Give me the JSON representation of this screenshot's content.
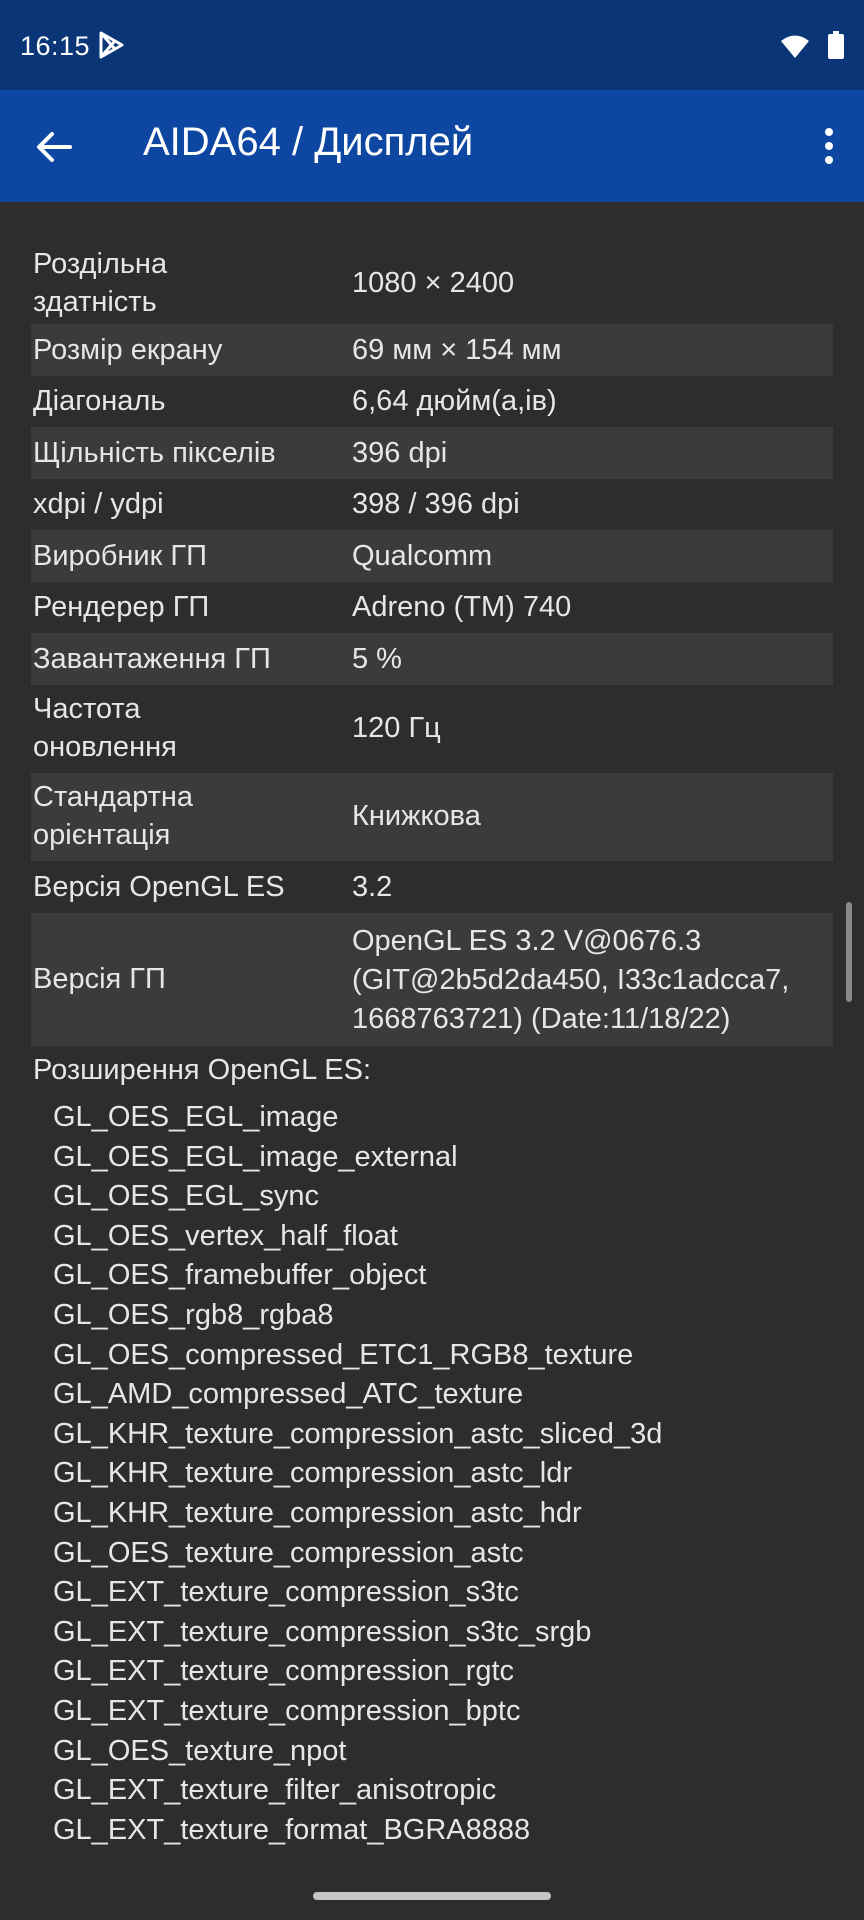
{
  "status_bar": {
    "time": "16:15"
  },
  "app_bar": {
    "title": "AIDA64 / Дисплей"
  },
  "rows": [
    {
      "label": "Роздільна\nздатність",
      "value": "1080 × 2400"
    },
    {
      "label": "Розмір екрану",
      "value": "69 мм × 154 мм"
    },
    {
      "label": "Діагональ",
      "value": "6,64 дюйм(а,ів)"
    },
    {
      "label": "Щільність пікселів",
      "value": "396 dpi"
    },
    {
      "label": "xdpi / ydpi",
      "value": "398 / 396 dpi"
    },
    {
      "label": "Виробник ГП",
      "value": "Qualcomm"
    },
    {
      "label": "Рендерер ГП",
      "value": "Adreno (TM) 740"
    },
    {
      "label": "Завантаження ГП",
      "value": "5 %"
    },
    {
      "label": "Частота\nоновлення",
      "value": "120 Гц"
    },
    {
      "label": "Стандартна\nорієнтація",
      "value": "Книжкова"
    },
    {
      "label": "Версія OpenGL ES",
      "value": "3.2"
    },
    {
      "label": "Версія ГП",
      "value": "OpenGL ES 3.2 V@0676.3\n(GIT@2b5d2da450, I33c1adcca7,\n1668763721) (Date:11/18/22)"
    }
  ],
  "extensions": {
    "header": "Розширення OpenGL ES:",
    "items": [
      "GL_OES_EGL_image",
      "GL_OES_EGL_image_external",
      "GL_OES_EGL_sync",
      "GL_OES_vertex_half_float",
      "GL_OES_framebuffer_object",
      "GL_OES_rgb8_rgba8",
      "GL_OES_compressed_ETC1_RGB8_texture",
      "GL_AMD_compressed_ATC_texture",
      "GL_KHR_texture_compression_astc_sliced_3d",
      "GL_KHR_texture_compression_astc_ldr",
      "GL_KHR_texture_compression_astc_hdr",
      "GL_OES_texture_compression_astc",
      "GL_EXT_texture_compression_s3tc",
      "GL_EXT_texture_compression_s3tc_srgb",
      "GL_EXT_texture_compression_rgtc",
      "GL_EXT_texture_compression_bptc",
      "GL_OES_texture_npot",
      "GL_EXT_texture_filter_anisotropic",
      "GL_EXT_texture_format_BGRA8888"
    ]
  },
  "icons": {
    "status": [
      "play-store-icon",
      "wifi-icon",
      "battery-icon"
    ],
    "app_bar": [
      "back-arrow-icon",
      "more-vert-icon"
    ]
  },
  "colors": {
    "status_bar": "#0a3577",
    "app_bar": "#0d47a1",
    "background": "#2d2d2d",
    "row_shade": "#3b3b3b",
    "text": "#e6e6e6"
  }
}
